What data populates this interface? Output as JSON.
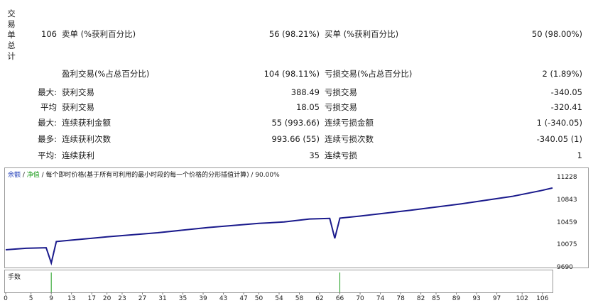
{
  "vertical_label": "交易单总计",
  "summary": {
    "total_trades": "106",
    "short_label": "卖单 (%获利百分比)",
    "short_value": "56 (98.21%)",
    "long_label": "买单 (%获利百分比)",
    "long_value": "50 (98.00%)"
  },
  "profit_loss": {
    "profit_label": "盈利交易(%占总百分比)",
    "profit_value": "104 (98.11%)",
    "loss_label": "亏损交易(%占总百分比)",
    "loss_value": "2 (1.89%)"
  },
  "stats": [
    {
      "prefix": "最大:",
      "left_label": "获利交易",
      "left_value": "388.49",
      "right_label": "亏损交易",
      "right_value": "-340.05"
    },
    {
      "prefix": "平均",
      "left_label": "获利交易",
      "left_value": "18.05",
      "right_label": "亏损交易",
      "right_value": "-320.41"
    },
    {
      "prefix": "最大:",
      "left_label": "连续获利金额",
      "left_value": "55 (993.66)",
      "right_label": "连续亏损金额",
      "right_value": "1 (-340.05)"
    },
    {
      "prefix": "最多:",
      "left_label": "连续获利次数",
      "left_value": "993.66 (55)",
      "right_label": "连续亏损次数",
      "right_value": "-340.05 (1)"
    },
    {
      "prefix": "平均:",
      "left_label": "连续获利",
      "left_value": "35",
      "right_label": "连续亏损",
      "right_value": "1"
    }
  ],
  "chart_title": {
    "balance": "余额",
    "sep1": " / ",
    "equity": "净值",
    "rest": " / 每个即时价格(基于所有可利用的最小时段的每一个价格的分形插值计算) / 90.00%"
  },
  "lots_label": "手数",
  "colors": {
    "balance_line": "#1a1a8c",
    "lots_bar": "#1a9c1a",
    "title_blue": "#1d3bb8",
    "title_green": "#1a9c1a"
  },
  "chart_data": {
    "type": "line",
    "x": [
      0,
      4,
      8,
      9,
      10,
      13,
      20,
      30,
      40,
      50,
      55,
      60,
      64,
      65,
      66,
      70,
      80,
      90,
      100,
      106,
      108
    ],
    "y": [
      10005,
      10030,
      10040,
      9780,
      10145,
      10170,
      10225,
      10295,
      10385,
      10455,
      10480,
      10530,
      10540,
      10200,
      10545,
      10580,
      10680,
      10790,
      10915,
      11020,
      11060
    ],
    "ylim": [
      9690,
      11300
    ],
    "y_ticks": [
      "11228",
      "10843",
      "10459",
      "10075",
      "9690"
    ],
    "y_tick_values": [
      11228,
      10843,
      10459,
      10075,
      9690
    ],
    "x_ticks": [
      "0",
      "5",
      "9",
      "13",
      "17",
      "20",
      "23",
      "27",
      "31",
      "35",
      "39",
      "43",
      "47",
      "50",
      "54",
      "58",
      "62",
      "66",
      "70",
      "74",
      "78",
      "82",
      "85",
      "89",
      "93",
      "97",
      "102",
      "106"
    ],
    "lots": [
      {
        "x": 9,
        "value": 1
      },
      {
        "x": 66,
        "value": 1
      }
    ]
  }
}
